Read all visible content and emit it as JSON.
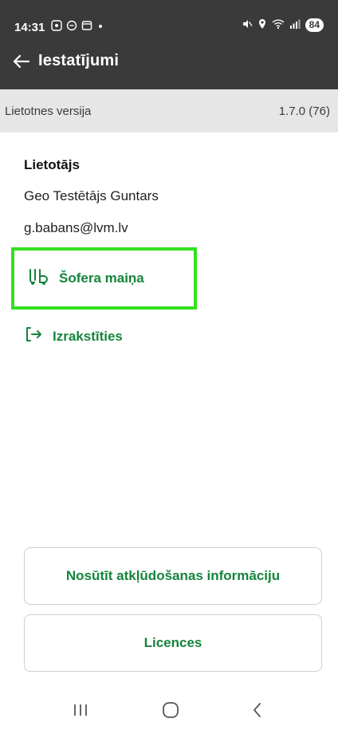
{
  "status_bar": {
    "time": "14:31",
    "battery": "84",
    "left_icons": [
      "screenshot-icon",
      "chat-icon",
      "calendar-icon",
      "dot-icon"
    ],
    "right_icons": [
      "mute-icon",
      "location-icon",
      "wifi-icon",
      "signal-icon"
    ]
  },
  "header": {
    "title": "Iestatījumi",
    "back_icon": "arrow-left-icon",
    "background": "#3a3a3a"
  },
  "version": {
    "label": "Lietotnes versija",
    "value": "1.7.0 (76)"
  },
  "user": {
    "section_label": "Lietotājs",
    "name": "Geo Testētājs Guntars",
    "email": "g.babans@lvm.lv"
  },
  "actions": {
    "driver_change": "Šofera maiņa",
    "driver_change_icon": "truck-change-icon",
    "logout": "Izrakstīties",
    "logout_icon": "logout-icon"
  },
  "buttons": {
    "debug_info": "Nosūtīt atkļūdošanas informāciju",
    "licences": "Licences"
  },
  "nav_bar": {
    "items": [
      "recents-icon",
      "home-icon",
      "back-icon"
    ]
  },
  "colors": {
    "accent": "#15843c",
    "highlight_border": "#33e020",
    "version_bg": "#e6e6e6"
  }
}
